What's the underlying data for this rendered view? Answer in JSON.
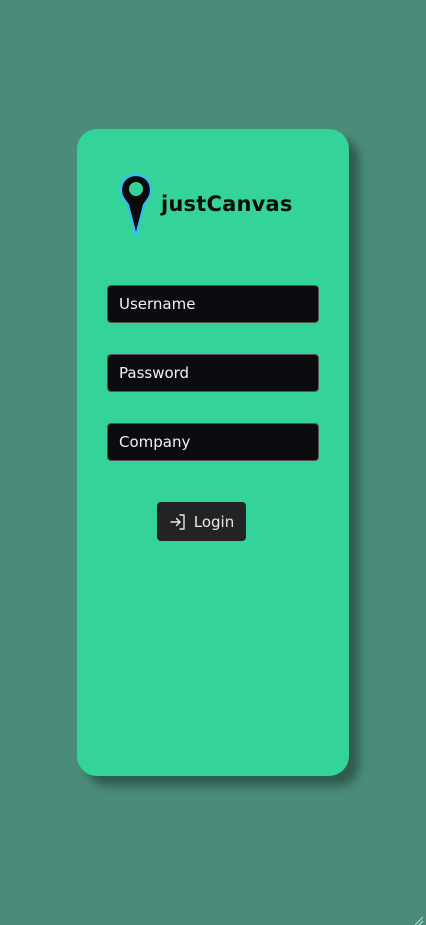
{
  "app": {
    "brand_name": "justCanvas"
  },
  "form": {
    "username_placeholder": "Username",
    "password_placeholder": "Password",
    "company_placeholder": "Company",
    "login_label": "Login"
  },
  "icons": {
    "logo": "location-pin-icon",
    "login": "sign-in-arrow-icon",
    "resize": "resize-grip-icon"
  },
  "colors": {
    "page_background": "#4a8c79",
    "card_background": "#34d399",
    "field_background": "#0c0b0f",
    "button_background": "#232325",
    "pin_outline": "#38bdf8"
  }
}
